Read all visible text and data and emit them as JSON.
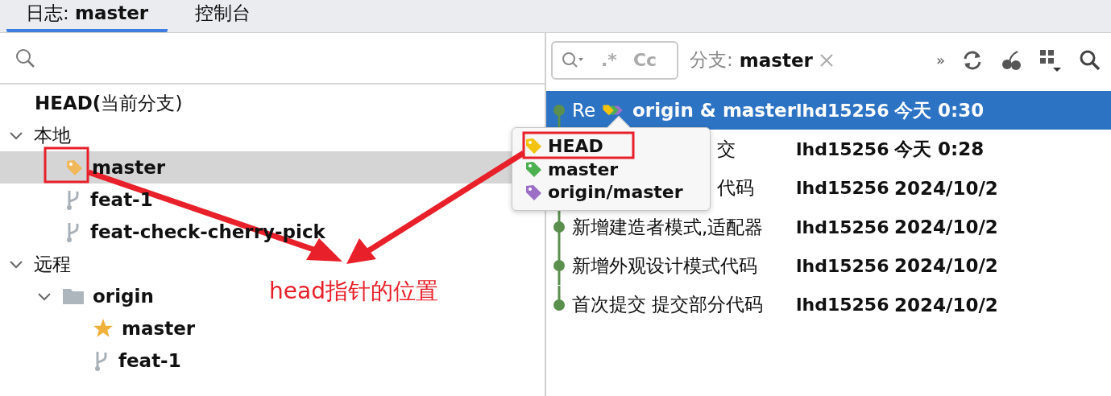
{
  "tabs": [
    {
      "label": "日志: **master**",
      "selected": true
    },
    {
      "label": "控制台",
      "selected": false
    }
  ],
  "branch_tree": {
    "items": [
      {
        "label": "HEAD(当前分支)",
        "kind": "head"
      },
      {
        "label": "本地",
        "kind": "group",
        "expanded": true,
        "children": [
          {
            "label": "master",
            "kind": "current",
            "selected": true
          },
          {
            "label": "feat-1",
            "kind": "branch",
            "selected": false
          },
          {
            "label": "feat-check-cherry-pick",
            "kind": "branch",
            "selected": false
          }
        ]
      },
      {
        "label": "远程",
        "kind": "group",
        "expanded": true,
        "children": [
          {
            "label": "origin",
            "kind": "folder",
            "expanded": true,
            "children": [
              {
                "label": "master",
                "kind": "favorite",
                "selected": false
              },
              {
                "label": "feat-1",
                "kind": "branch",
                "selected": false
              }
            ]
          }
        ]
      }
    ]
  },
  "log_toolbar": {
    "regex_toggle": ".*",
    "case_toggle": "Cc",
    "branch_filter_label": "分支:",
    "branch_filter_value": "master",
    "more": "»"
  },
  "commits": [
    {
      "message": "Re",
      "refs": "origin & master",
      "author": "lhd15256",
      "date": "今天 0:30",
      "selected": true
    },
    {
      "message": "交",
      "author": "lhd15256",
      "date": "今天 0:28",
      "selected": false
    },
    {
      "message": "代码",
      "author": "lhd15256",
      "date": "2024/10/2",
      "selected": false
    },
    {
      "message": "新增建造者模式,适配器",
      "author": "lhd15256",
      "date": "2024/10/2",
      "selected": false
    },
    {
      "message": "新增外观设计模式代码",
      "author": "lhd15256",
      "date": "2024/10/2",
      "selected": false
    },
    {
      "message": "首次提交 提交部分代码",
      "author": "lhd15256",
      "date": "2024/10/2",
      "selected": false
    }
  ],
  "ref_popup": {
    "refs": [
      {
        "name": "HEAD",
        "color": "#f2c40f"
      },
      {
        "name": "master",
        "color": "#4caf50"
      },
      {
        "name": "origin/master",
        "color": "#9c6fc7"
      }
    ]
  },
  "annotation": {
    "text": "head指针的位置"
  }
}
